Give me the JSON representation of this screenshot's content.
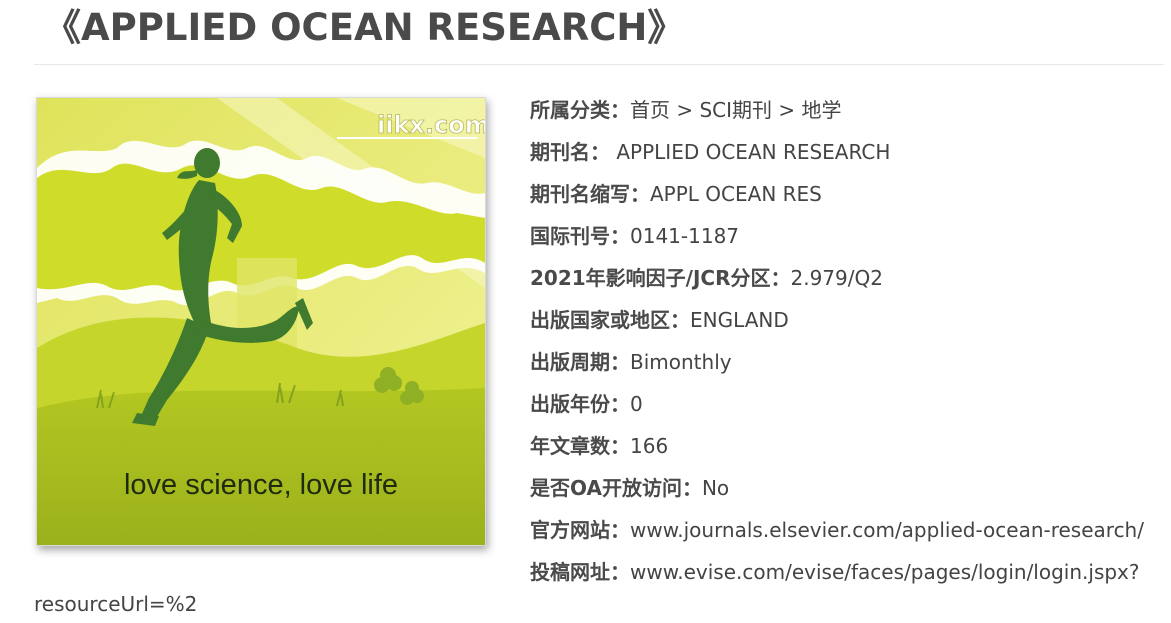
{
  "page": {
    "title": "《APPLIED OCEAN RESEARCH》"
  },
  "cover": {
    "watermark": "iikx.com",
    "slogan": "love science, love life",
    "colors": {
      "sky": "#e8ea6a",
      "leaf": "#c7d61c",
      "grass": "#a6bb1e",
      "runner": "#3f7a2e"
    }
  },
  "info": {
    "category": {
      "label": "所属分类：",
      "crumbs": [
        "首页",
        "SCI期刊",
        "地学"
      ],
      "sep": " > "
    },
    "name": {
      "label": "期刊名：",
      "value": " APPLIED OCEAN RESEARCH"
    },
    "abbr": {
      "label": "期刊名缩写：",
      "value": "APPL OCEAN RES"
    },
    "issn": {
      "label": "国际刊号：",
      "value": "0141-1187"
    },
    "impact": {
      "label": "2021年影响因子/JCR分区：",
      "value": "2.979/Q2"
    },
    "country": {
      "label": "出版国家或地区：",
      "value": "ENGLAND"
    },
    "frequency": {
      "label": "出版周期：",
      "value": "Bimonthly"
    },
    "year": {
      "label": "出版年份：",
      "value": "0"
    },
    "articles": {
      "label": "年文章数：",
      "value": "166"
    },
    "oa": {
      "label": "是否OA开放访问：",
      "value": "No"
    },
    "website": {
      "label": "官方网站：",
      "value": "www.journals.elsevier.com/applied-ocean-research/"
    },
    "submit": {
      "label": "投稿网址：",
      "value": "www.evise.com/evise/faces/pages/login/login.jspx?",
      "value_cont": "resourceUrl=%2"
    }
  }
}
